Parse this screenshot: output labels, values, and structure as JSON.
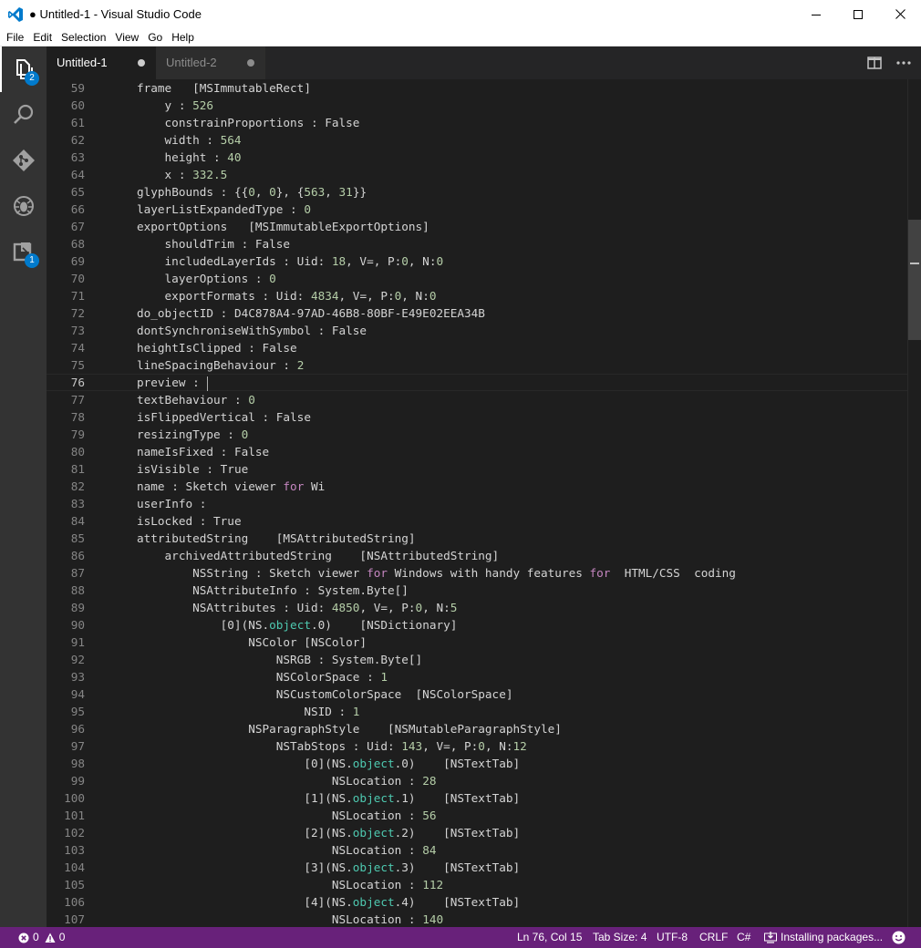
{
  "window": {
    "title": "● Untitled-1 - Visual Studio Code"
  },
  "menu": [
    "File",
    "Edit",
    "Selection",
    "View",
    "Go",
    "Help"
  ],
  "activity_bar": {
    "explorer_badge": "2",
    "extensions_badge": "1"
  },
  "tabs": [
    {
      "label": "Untitled-1",
      "active": true,
      "dirty": true
    },
    {
      "label": "Untitled-2",
      "active": false,
      "dirty": true
    }
  ],
  "editor": {
    "current_line": 76,
    "lines": [
      {
        "n": "59",
        "indent": 1,
        "segs": [
          [
            "t",
            "frame   [MSImmutableRect]"
          ]
        ]
      },
      {
        "n": "60",
        "indent": 2,
        "segs": [
          [
            "t",
            "y : "
          ],
          [
            "n",
            "526"
          ]
        ]
      },
      {
        "n": "61",
        "indent": 2,
        "segs": [
          [
            "t",
            "constrainProportions : False"
          ]
        ]
      },
      {
        "n": "62",
        "indent": 2,
        "segs": [
          [
            "t",
            "width : "
          ],
          [
            "n",
            "564"
          ]
        ]
      },
      {
        "n": "63",
        "indent": 2,
        "segs": [
          [
            "t",
            "height : "
          ],
          [
            "n",
            "40"
          ]
        ]
      },
      {
        "n": "64",
        "indent": 2,
        "segs": [
          [
            "t",
            "x : "
          ],
          [
            "n",
            "332.5"
          ]
        ]
      },
      {
        "n": "65",
        "indent": 1,
        "segs": [
          [
            "t",
            "glyphBounds : {{"
          ],
          [
            "n",
            "0"
          ],
          [
            "t",
            ", "
          ],
          [
            "n",
            "0"
          ],
          [
            "t",
            "}, {"
          ],
          [
            "n",
            "563"
          ],
          [
            "t",
            ", "
          ],
          [
            "n",
            "31"
          ],
          [
            "t",
            "}}"
          ]
        ]
      },
      {
        "n": "66",
        "indent": 1,
        "segs": [
          [
            "t",
            "layerListExpandedType : "
          ],
          [
            "n",
            "0"
          ]
        ]
      },
      {
        "n": "67",
        "indent": 1,
        "segs": [
          [
            "t",
            "exportOptions   [MSImmutableExportOptions]"
          ]
        ]
      },
      {
        "n": "68",
        "indent": 2,
        "segs": [
          [
            "t",
            "shouldTrim : False"
          ]
        ]
      },
      {
        "n": "69",
        "indent": 2,
        "segs": [
          [
            "t",
            "includedLayerIds : Uid: "
          ],
          [
            "n",
            "18"
          ],
          [
            "t",
            ", V=, P:"
          ],
          [
            "n",
            "0"
          ],
          [
            "t",
            ", N:"
          ],
          [
            "n",
            "0"
          ]
        ]
      },
      {
        "n": "70",
        "indent": 2,
        "segs": [
          [
            "t",
            "layerOptions : "
          ],
          [
            "n",
            "0"
          ]
        ]
      },
      {
        "n": "71",
        "indent": 2,
        "segs": [
          [
            "t",
            "exportFormats : Uid: "
          ],
          [
            "n",
            "4834"
          ],
          [
            "t",
            ", V=, P:"
          ],
          [
            "n",
            "0"
          ],
          [
            "t",
            ", N:"
          ],
          [
            "n",
            "0"
          ]
        ]
      },
      {
        "n": "72",
        "indent": 1,
        "segs": [
          [
            "t",
            "do_objectID : D4C878A4-97AD-46B8-80BF-E49E02EEA34B"
          ]
        ]
      },
      {
        "n": "73",
        "indent": 1,
        "segs": [
          [
            "t",
            "dontSynchroniseWithSymbol : False"
          ]
        ]
      },
      {
        "n": "74",
        "indent": 1,
        "segs": [
          [
            "t",
            "heightIsClipped : False"
          ]
        ]
      },
      {
        "n": "75",
        "indent": 1,
        "segs": [
          [
            "t",
            "lineSpacingBehaviour : "
          ],
          [
            "n",
            "2"
          ]
        ]
      },
      {
        "n": "76",
        "indent": 1,
        "segs": [
          [
            "t",
            "preview : "
          ]
        ]
      },
      {
        "n": "77",
        "indent": 1,
        "segs": [
          [
            "t",
            "textBehaviour : "
          ],
          [
            "n",
            "0"
          ]
        ]
      },
      {
        "n": "78",
        "indent": 1,
        "segs": [
          [
            "t",
            "isFlippedVertical : False"
          ]
        ]
      },
      {
        "n": "79",
        "indent": 1,
        "segs": [
          [
            "t",
            "resizingType : "
          ],
          [
            "n",
            "0"
          ]
        ]
      },
      {
        "n": "80",
        "indent": 1,
        "segs": [
          [
            "t",
            "nameIsFixed : False"
          ]
        ]
      },
      {
        "n": "81",
        "indent": 1,
        "segs": [
          [
            "t",
            "isVisible : True"
          ]
        ]
      },
      {
        "n": "82",
        "indent": 1,
        "segs": [
          [
            "t",
            "name : Sketch viewer "
          ],
          [
            "k",
            "for"
          ],
          [
            "t",
            " Wi"
          ]
        ]
      },
      {
        "n": "83",
        "indent": 1,
        "segs": [
          [
            "t",
            "userInfo :"
          ]
        ]
      },
      {
        "n": "84",
        "indent": 1,
        "segs": [
          [
            "t",
            "isLocked : True"
          ]
        ]
      },
      {
        "n": "85",
        "indent": 1,
        "segs": [
          [
            "t",
            "attributedString    [MSAttributedString]"
          ]
        ]
      },
      {
        "n": "86",
        "indent": 2,
        "segs": [
          [
            "t",
            "archivedAttributedString    [NSAttributedString]"
          ]
        ]
      },
      {
        "n": "87",
        "indent": 3,
        "segs": [
          [
            "t",
            "NSString : Sketch viewer "
          ],
          [
            "k",
            "for"
          ],
          [
            "t",
            " Windows with handy features "
          ],
          [
            "k",
            "for"
          ],
          [
            "t",
            "  HTML/CSS  coding"
          ]
        ]
      },
      {
        "n": "88",
        "indent": 3,
        "segs": [
          [
            "t",
            "NSAttributeInfo : System.Byte[]"
          ]
        ]
      },
      {
        "n": "89",
        "indent": 3,
        "segs": [
          [
            "t",
            "NSAttributes : Uid: "
          ],
          [
            "n",
            "4850"
          ],
          [
            "t",
            ", V=, P:"
          ],
          [
            "n",
            "0"
          ],
          [
            "t",
            ", N:"
          ],
          [
            "n",
            "5"
          ]
        ]
      },
      {
        "n": "90",
        "indent": 4,
        "segs": [
          [
            "t",
            "[0](NS."
          ],
          [
            "y",
            "object"
          ],
          [
            "t",
            ".0)    [NSDictionary]"
          ]
        ]
      },
      {
        "n": "91",
        "indent": 5,
        "segs": [
          [
            "t",
            "NSColor [NSColor]"
          ]
        ]
      },
      {
        "n": "92",
        "indent": 6,
        "segs": [
          [
            "t",
            "NSRGB : System.Byte[]"
          ]
        ]
      },
      {
        "n": "93",
        "indent": 6,
        "segs": [
          [
            "t",
            "NSColorSpace : "
          ],
          [
            "n",
            "1"
          ]
        ]
      },
      {
        "n": "94",
        "indent": 6,
        "segs": [
          [
            "t",
            "NSCustomColorSpace  [NSColorSpace]"
          ]
        ]
      },
      {
        "n": "95",
        "indent": 7,
        "segs": [
          [
            "t",
            "NSID : "
          ],
          [
            "n",
            "1"
          ]
        ]
      },
      {
        "n": "96",
        "indent": 5,
        "segs": [
          [
            "t",
            "NSParagraphStyle    [NSMutableParagraphStyle]"
          ]
        ]
      },
      {
        "n": "97",
        "indent": 6,
        "segs": [
          [
            "t",
            "NSTabStops : Uid: "
          ],
          [
            "n",
            "143"
          ],
          [
            "t",
            ", V=, P:"
          ],
          [
            "n",
            "0"
          ],
          [
            "t",
            ", N:"
          ],
          [
            "n",
            "12"
          ]
        ]
      },
      {
        "n": "98",
        "indent": 7,
        "segs": [
          [
            "t",
            "[0](NS."
          ],
          [
            "y",
            "object"
          ],
          [
            "t",
            ".0)    [NSTextTab]"
          ]
        ]
      },
      {
        "n": "99",
        "indent": 8,
        "segs": [
          [
            "t",
            "NSLocation : "
          ],
          [
            "n",
            "28"
          ]
        ]
      },
      {
        "n": "100",
        "indent": 7,
        "segs": [
          [
            "t",
            "[1](NS."
          ],
          [
            "y",
            "object"
          ],
          [
            "t",
            ".1)    [NSTextTab]"
          ]
        ]
      },
      {
        "n": "101",
        "indent": 8,
        "segs": [
          [
            "t",
            "NSLocation : "
          ],
          [
            "n",
            "56"
          ]
        ]
      },
      {
        "n": "102",
        "indent": 7,
        "segs": [
          [
            "t",
            "[2](NS."
          ],
          [
            "y",
            "object"
          ],
          [
            "t",
            ".2)    [NSTextTab]"
          ]
        ]
      },
      {
        "n": "103",
        "indent": 8,
        "segs": [
          [
            "t",
            "NSLocation : "
          ],
          [
            "n",
            "84"
          ]
        ]
      },
      {
        "n": "104",
        "indent": 7,
        "segs": [
          [
            "t",
            "[3](NS."
          ],
          [
            "y",
            "object"
          ],
          [
            "t",
            ".3)    [NSTextTab]"
          ]
        ]
      },
      {
        "n": "105",
        "indent": 8,
        "segs": [
          [
            "t",
            "NSLocation : "
          ],
          [
            "n",
            "112"
          ]
        ]
      },
      {
        "n": "106",
        "indent": 7,
        "segs": [
          [
            "t",
            "[4](NS."
          ],
          [
            "y",
            "object"
          ],
          [
            "t",
            ".4)    [NSTextTab]"
          ]
        ]
      },
      {
        "n": "107",
        "indent": 8,
        "segs": [
          [
            "t",
            "NSLocation : "
          ],
          [
            "n",
            "140"
          ]
        ]
      }
    ]
  },
  "status_bar": {
    "errors": "0",
    "warnings": "0",
    "position": "Ln 76, Col 15",
    "tab_size": "Tab Size: 4",
    "encoding": "UTF-8",
    "eol": "CRLF",
    "language": "C#",
    "task": "Installing packages..."
  },
  "colors": {
    "status_bar": "#68217a",
    "activity_bar": "#333333",
    "editor_bg": "#1e1e1e",
    "badge": "#007acc",
    "number": "#b5cea8",
    "keyword": "#c586c0",
    "type": "#4ec9b0"
  }
}
